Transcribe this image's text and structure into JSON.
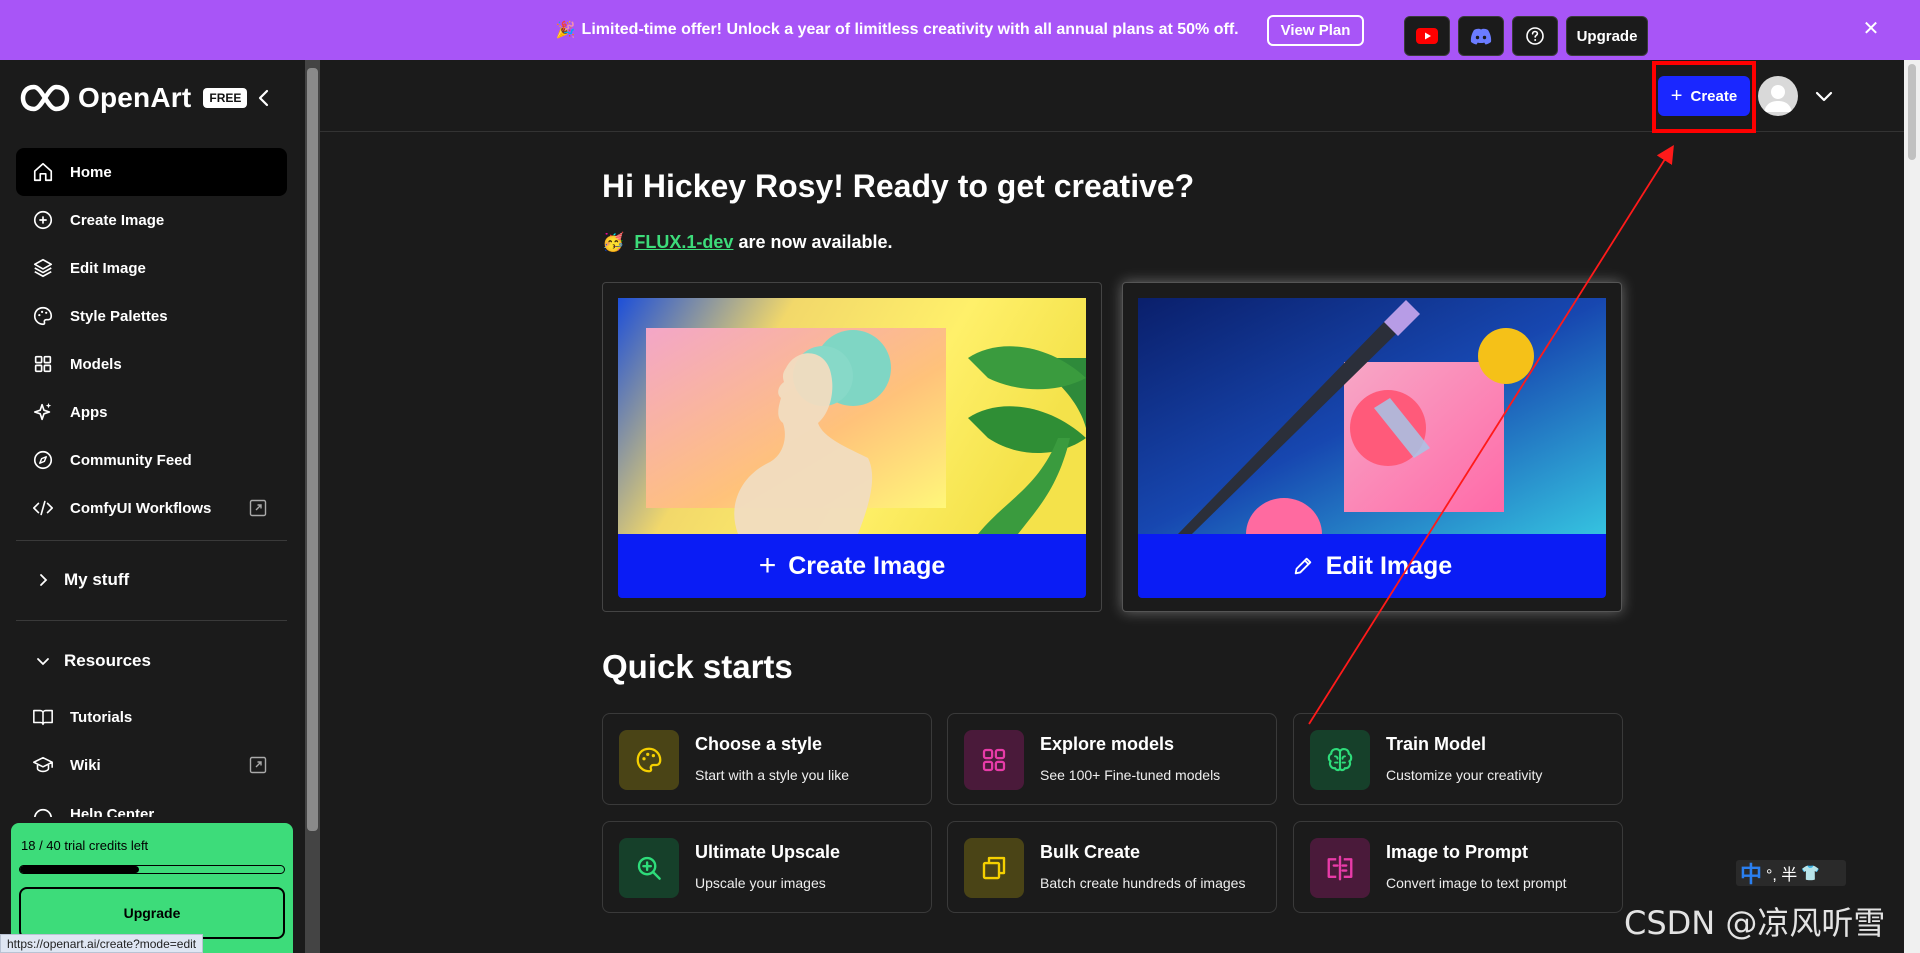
{
  "banner": {
    "text": "Limited-time offer! Unlock a year of limitless creativity with all annual plans at 50% off.",
    "button": "View Plan"
  },
  "sidebar": {
    "logo": "OpenArt",
    "badge": "FREE",
    "items": [
      {
        "label": "Home"
      },
      {
        "label": "Create Image"
      },
      {
        "label": "Edit Image"
      },
      {
        "label": "Style Palettes"
      },
      {
        "label": "Models"
      },
      {
        "label": "Apps"
      },
      {
        "label": "Community Feed"
      },
      {
        "label": "ComfyUI Workflows"
      }
    ],
    "my_stuff": "My stuff",
    "resources": "Resources",
    "resource_items": [
      {
        "label": "Tutorials"
      },
      {
        "label": "Wiki"
      },
      {
        "label": "Help Center"
      }
    ],
    "credits": {
      "text": "18 / 40 trial credits left",
      "used_fraction": 0.45,
      "button": "Upgrade"
    }
  },
  "status_url": "https://openart.ai/create?mode=edit",
  "topbar": {
    "upgrade": "Upgrade",
    "create": "Create"
  },
  "main": {
    "greeting": "Hi Hickey Rosy! Ready to get creative?",
    "flux_link": "FLUX.1-dev",
    "flux_suffix": "are now available.",
    "hero": [
      {
        "label": "Create Image"
      },
      {
        "label": "Edit Image"
      }
    ],
    "quick_starts_title": "Quick starts",
    "quick_starts": [
      {
        "title": "Choose a style",
        "subtitle": "Start with a style you like",
        "icon": "palette-icon",
        "color": "#f5d000",
        "bg": "#4a4416"
      },
      {
        "title": "Explore models",
        "subtitle": "See 100+ Fine-tuned models",
        "icon": "grid-icon",
        "color": "#e83ba8",
        "bg": "#4a1a3a"
      },
      {
        "title": "Train Model",
        "subtitle": "Customize your creativity",
        "icon": "brain-icon",
        "color": "#2edc7a",
        "bg": "#16402a"
      },
      {
        "title": "Ultimate Upscale",
        "subtitle": "Upscale your images",
        "icon": "zoom-in-icon",
        "color": "#2edc7a",
        "bg": "#16402a"
      },
      {
        "title": "Bulk Create",
        "subtitle": "Batch create hundreds of images",
        "icon": "copy-icon",
        "color": "#f5d000",
        "bg": "#4a4416"
      },
      {
        "title": "Image to Prompt",
        "subtitle": "Convert image to text prompt",
        "icon": "image-to-prompt-icon",
        "color": "#e83ba8",
        "bg": "#4a1a3a"
      }
    ]
  },
  "ime": {
    "zh": "中",
    "rest": "°, 半"
  },
  "watermark": "CSDN @凉风听雪",
  "colors": {
    "accent": "#1a27ff",
    "banner": "#a855f7",
    "credits": "#3ddc7a",
    "link": "#3ddc7a"
  }
}
